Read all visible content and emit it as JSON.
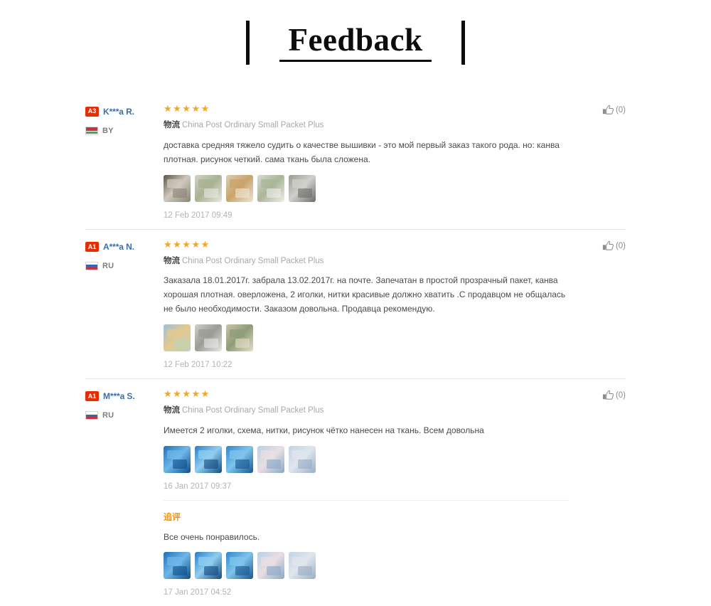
{
  "header": {
    "title": "Feedback",
    "left_bar": "vertical-bar",
    "right_bar": "vertical-bar"
  },
  "reviews": [
    {
      "level_badge": "A3",
      "user_name": "K***a R.",
      "country_code": "BY",
      "country_flag": "flag-by",
      "rating": 5,
      "stars": "★★★★★",
      "logistics_label": "物流",
      "logistics_value": "China Post Ordinary Small Packet Plus",
      "text": "доставка средняя тяжело судить о качестве вышивки - это мой первый заказ такого рода. но: канва плотная. рисунок четкий. сама ткань была сложена.",
      "date": "12 Feb 2017 09:49",
      "like_count": "(0)",
      "thumbnails": [
        {
          "name": "review-photo-1",
          "c1": "#5c5248",
          "c2": "#cfc8bd",
          "c3": "#8b8377"
        },
        {
          "name": "review-photo-2",
          "c1": "#cfd4c3",
          "c2": "#a9b293",
          "c3": "#e6e8de"
        },
        {
          "name": "review-photo-3",
          "c1": "#d8cfb8",
          "c2": "#c9a36b",
          "c3": "#ece6d6"
        },
        {
          "name": "review-photo-4",
          "c1": "#d7dbcf",
          "c2": "#aab59a",
          "c3": "#eeefe8"
        },
        {
          "name": "review-photo-5",
          "c1": "#9a9a92",
          "c2": "#cfd0cb",
          "c3": "#6e6e68"
        }
      ]
    },
    {
      "level_badge": "A1",
      "user_name": "A***a N.",
      "country_code": "RU",
      "country_flag": "flag-ru",
      "rating": 5,
      "stars": "★★★★★",
      "logistics_label": "物流",
      "logistics_value": "China Post Ordinary Small Packet Plus",
      "text": "Заказала 18.01.2017г. забрала 13.02.2017г. на почте. Запечатан в простой прозрачный пакет, канва хорошая плотная. оверложена, 2 иголки, нитки красивые должно хватить .С продавцом не общалась не было необходимости. Заказом довольна. Продавца рекомендую.",
      "date": "12 Feb 2017 10:22",
      "like_count": "(0)",
      "thumbnails": [
        {
          "name": "review-photo-1",
          "c1": "#9fc0d8",
          "c2": "#e3c98f",
          "c3": "#c0d3b6"
        },
        {
          "name": "review-photo-2",
          "c1": "#cfcfcb",
          "c2": "#9c9c96",
          "c3": "#e8e8e4"
        },
        {
          "name": "review-photo-3",
          "c1": "#cbc3a8",
          "c2": "#8f9c7a",
          "c3": "#e6ddc6"
        }
      ]
    },
    {
      "level_badge": "A1",
      "user_name": "M***a S.",
      "country_code": "RU",
      "country_flag": "flag-ru",
      "rating": 5,
      "stars": "★★★★★",
      "logistics_label": "物流",
      "logistics_value": "China Post Ordinary Small Packet Plus",
      "text": "Имеется 2 иголки, схема, нитки, рисунок чётко нанесен на ткань. Всем довольна",
      "date": "16 Jan 2017 09:37",
      "like_count": "(0)",
      "thumbnails": [
        {
          "name": "review-photo-1",
          "c1": "#1f6fb5",
          "c2": "#6fb7e8",
          "c3": "#0d4f8c"
        },
        {
          "name": "review-photo-2",
          "c1": "#2a7ec4",
          "c2": "#8fcdf0",
          "c3": "#134a80"
        },
        {
          "name": "review-photo-3",
          "c1": "#2f86cc",
          "c2": "#7fc4ec",
          "c3": "#175690"
        },
        {
          "name": "review-photo-4",
          "c1": "#b9cfe4",
          "c2": "#e8dfe2",
          "c3": "#8aa9c6"
        },
        {
          "name": "review-photo-5",
          "c1": "#c3d2e2",
          "c2": "#dfe6ee",
          "c3": "#9aaec4"
        }
      ],
      "addon": {
        "title": "追评",
        "text": "Все очень понравилось.",
        "date": "17 Jan 2017 04:52",
        "thumbnails": [
          {
            "name": "addon-photo-1",
            "c1": "#1f6fb5",
            "c2": "#6fb7e8",
            "c3": "#0d4f8c"
          },
          {
            "name": "addon-photo-2",
            "c1": "#2a7ec4",
            "c2": "#8fcdf0",
            "c3": "#134a80"
          },
          {
            "name": "addon-photo-3",
            "c1": "#2f86cc",
            "c2": "#7fc4ec",
            "c3": "#175690"
          },
          {
            "name": "addon-photo-4",
            "c1": "#b9cfe4",
            "c2": "#e8dfe2",
            "c3": "#8aa9c6"
          },
          {
            "name": "addon-photo-5",
            "c1": "#c3d2e2",
            "c2": "#dfe6ee",
            "c3": "#9aaec4"
          }
        ]
      }
    }
  ],
  "colors": {
    "badge": "#e62e04",
    "star": "#f5a623",
    "username": "#3c6ea5",
    "addon_title": "#f0940a",
    "date": "#b4b4b4"
  }
}
